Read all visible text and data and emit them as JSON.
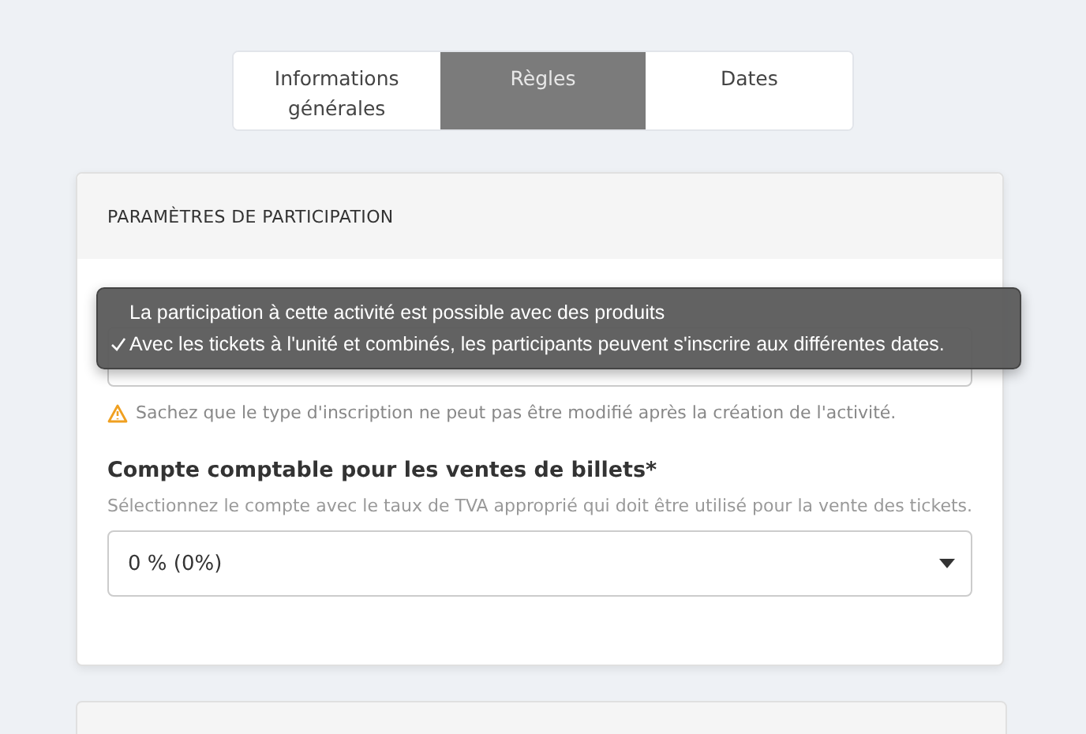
{
  "tabs": [
    {
      "label": "Informations générales",
      "selected": false
    },
    {
      "label": "Règles",
      "selected": true
    },
    {
      "label": "Dates",
      "selected": false
    }
  ],
  "card": {
    "title": "PARAMÈTRES DE PARTICIPATION",
    "registration": {
      "warning": "Sachez que le type d'inscription ne peut pas être modifié après la création de l'activité.",
      "menu": [
        {
          "label": "La participation à cette activité est possible avec des produits",
          "checked": false
        },
        {
          "label": "Avec les tickets à l'unité et combinés, les participants peuvent s'inscrire aux différentes dates.",
          "checked": true
        }
      ]
    },
    "account": {
      "label": "Compte comptable pour les ventes de billets*",
      "hint": "Sélectionnez le compte avec le taux de TVA approprié qui doit être utilisé pour la vente des tickets.",
      "value": "0 % (0%)"
    }
  }
}
